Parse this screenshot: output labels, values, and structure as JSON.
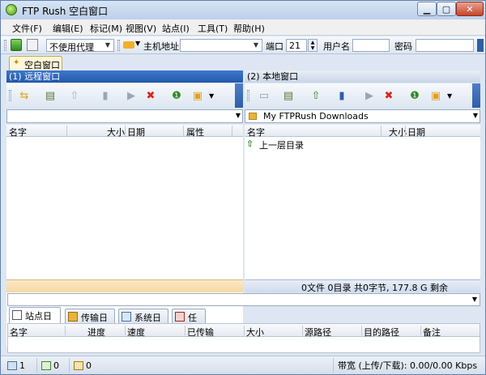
{
  "window": {
    "title": "FTP Rush  空白窗口"
  },
  "menu": [
    "文件(F)",
    "编辑(E)",
    "标记(M)",
    "视图(V)",
    "站点(I)",
    "工具(T)",
    "帮助(H)"
  ],
  "connect_bar": {
    "proxy_value": "不使用代理",
    "host_label": "主机地址",
    "host_value": "",
    "port_label": "端口",
    "port_value": "21",
    "user_label": "用户名",
    "user_value": "",
    "pass_label": "密码",
    "pass_value": ""
  },
  "doc_tab": {
    "label": "空白窗口"
  },
  "remote": {
    "header": "(1) 远程窗口",
    "path": "",
    "columns": [
      "名字",
      "大小",
      "日期",
      "属性"
    ]
  },
  "local": {
    "header": "(2) 本地窗口",
    "path": "My FTPRush Downloads",
    "columns": [
      "名字",
      "大小",
      "日期"
    ],
    "rows": [
      {
        "name": "上一层目录"
      }
    ],
    "status": "0文件 0目录 共0字节, 177.8 G 剩余"
  },
  "log_tabs": [
    "站点日志",
    "传输日志",
    "系统日志",
    "任务"
  ],
  "log_columns": [
    "名字",
    "进度",
    "速度",
    "已传输",
    "大小",
    "源路径",
    "目的路径",
    "备注"
  ],
  "statusbar": {
    "count1": "1",
    "count2": "0",
    "count3": "0",
    "bandwidth": "带宽 (上传/下载): 0.00/0.00 Kbps"
  }
}
